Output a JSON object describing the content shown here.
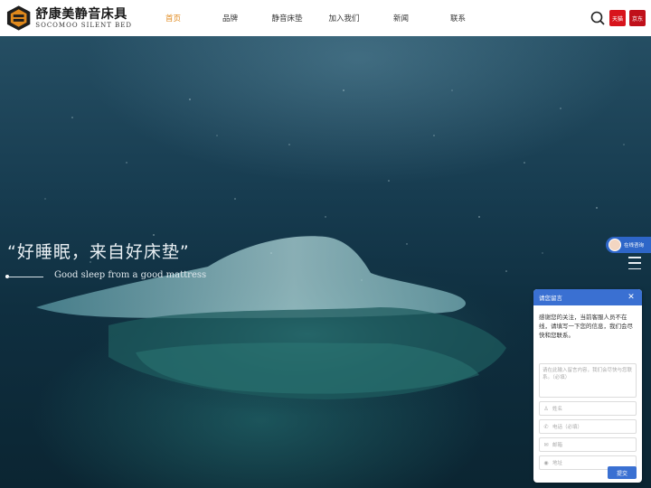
{
  "header": {
    "logo": {
      "cn_name": "舒康美",
      "cn_tagline": "静音床具",
      "en_name": "SOCOMOO SILENT BED"
    },
    "nav": [
      {
        "label": "首页",
        "active": true
      },
      {
        "label": "品牌",
        "active": false
      },
      {
        "label": "静音床垫",
        "active": false
      },
      {
        "label": "加入我们",
        "active": false
      },
      {
        "label": "新闻",
        "active": false
      },
      {
        "label": "联系",
        "active": false
      }
    ],
    "tmall_label": "天猫",
    "jd_label": "京东",
    "accent_color": "#e08a1e"
  },
  "hero": {
    "slogan_cn": "“好睡眠，来自好床垫”",
    "slogan_en": "Good sleep from a good mattress"
  },
  "side": {
    "online_label": "在线咨询"
  },
  "widget": {
    "title": "请您留言",
    "message": "感谢您的关注，当前客服人员不在线，请填写一下您的信息，我们会尽快和您联系。",
    "textarea_placeholder": "请在此输入留言内容，我们会尽快与您联系。（必填）",
    "fields": [
      {
        "icon": "user-icon",
        "placeholder": "姓名"
      },
      {
        "icon": "phone-icon",
        "placeholder": "电话（必填）"
      },
      {
        "icon": "mail-icon",
        "placeholder": "邮箱"
      },
      {
        "icon": "location-icon",
        "placeholder": "地址"
      }
    ],
    "submit_label": "提交",
    "accent_color": "#3a70d2"
  }
}
